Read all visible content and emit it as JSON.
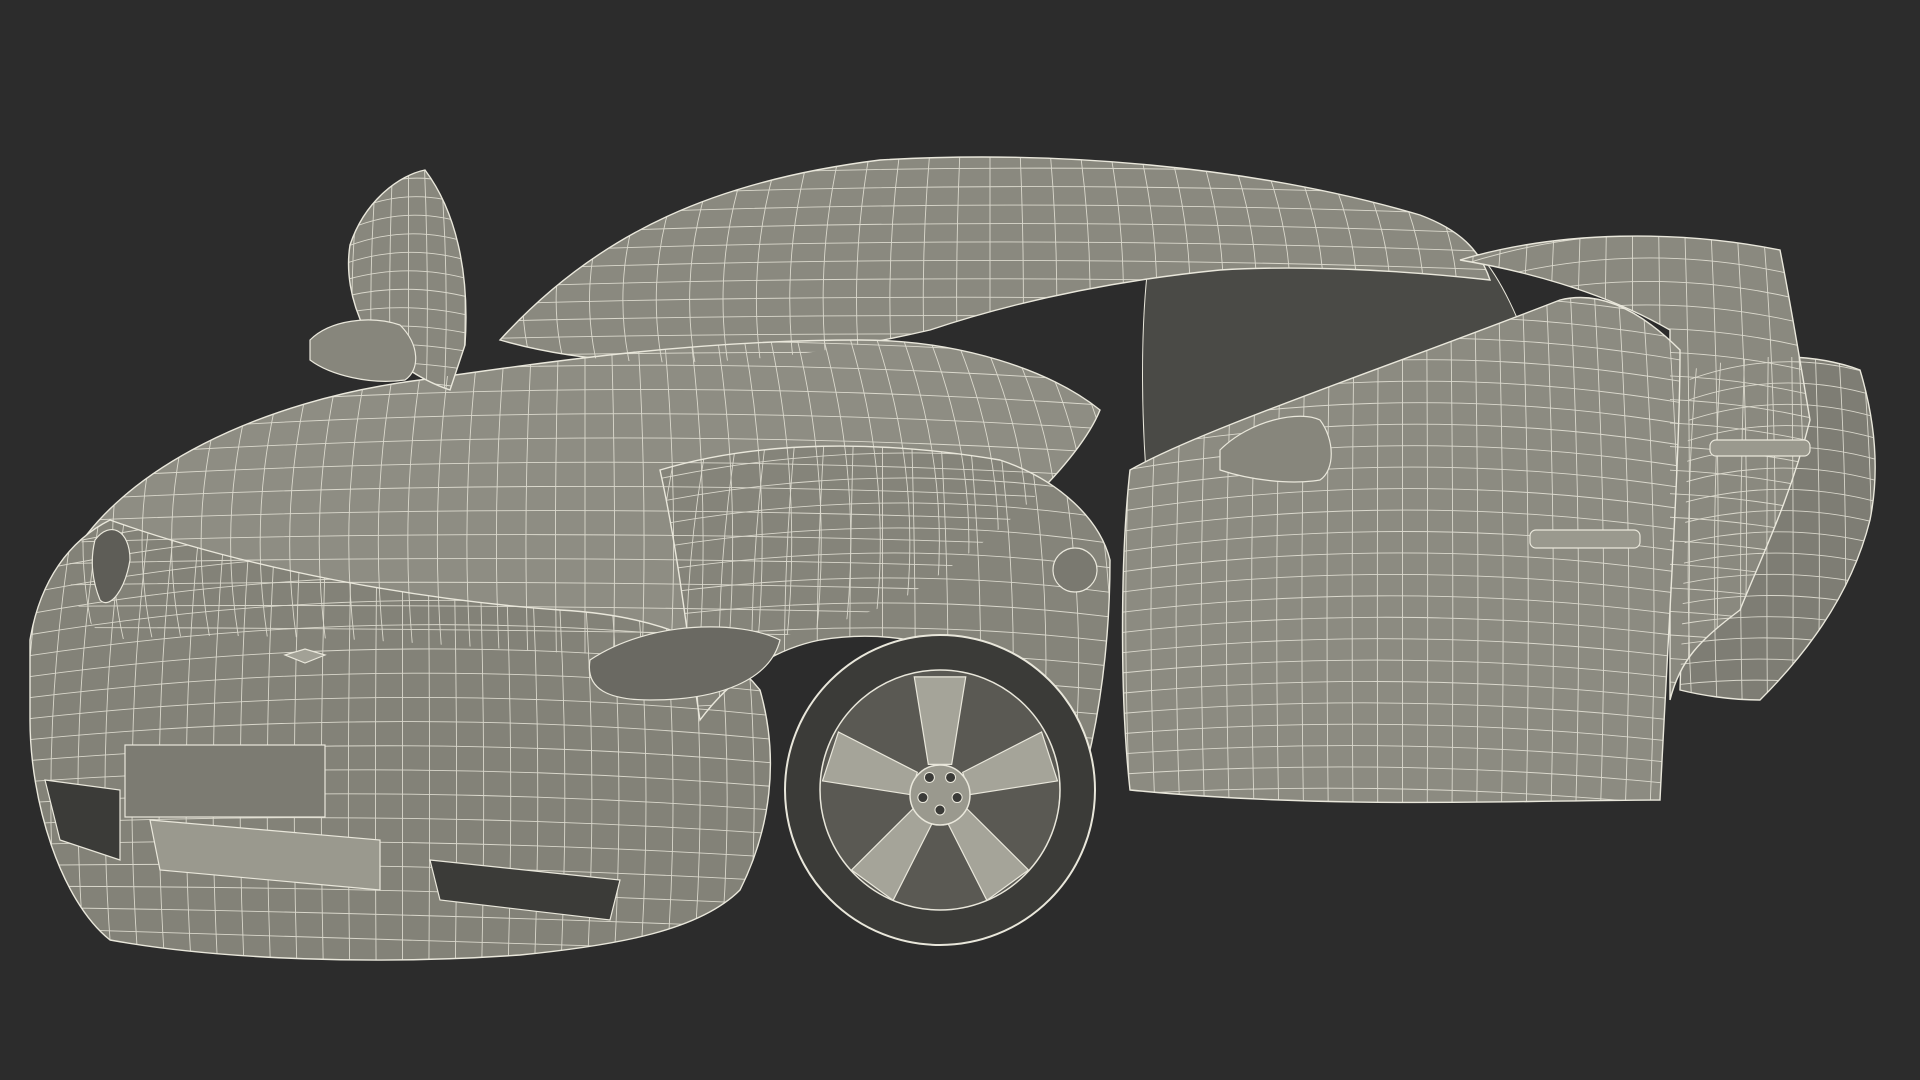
{
  "scene": {
    "background_color": "#2c2c2c",
    "surface_color": "#8a897f",
    "surface_shadow_color": "#6f6e66",
    "surface_dark_color": "#3b3b38",
    "wire_color": "#e9e7db",
    "subject": "wireframe-sports-car-doors-open"
  }
}
